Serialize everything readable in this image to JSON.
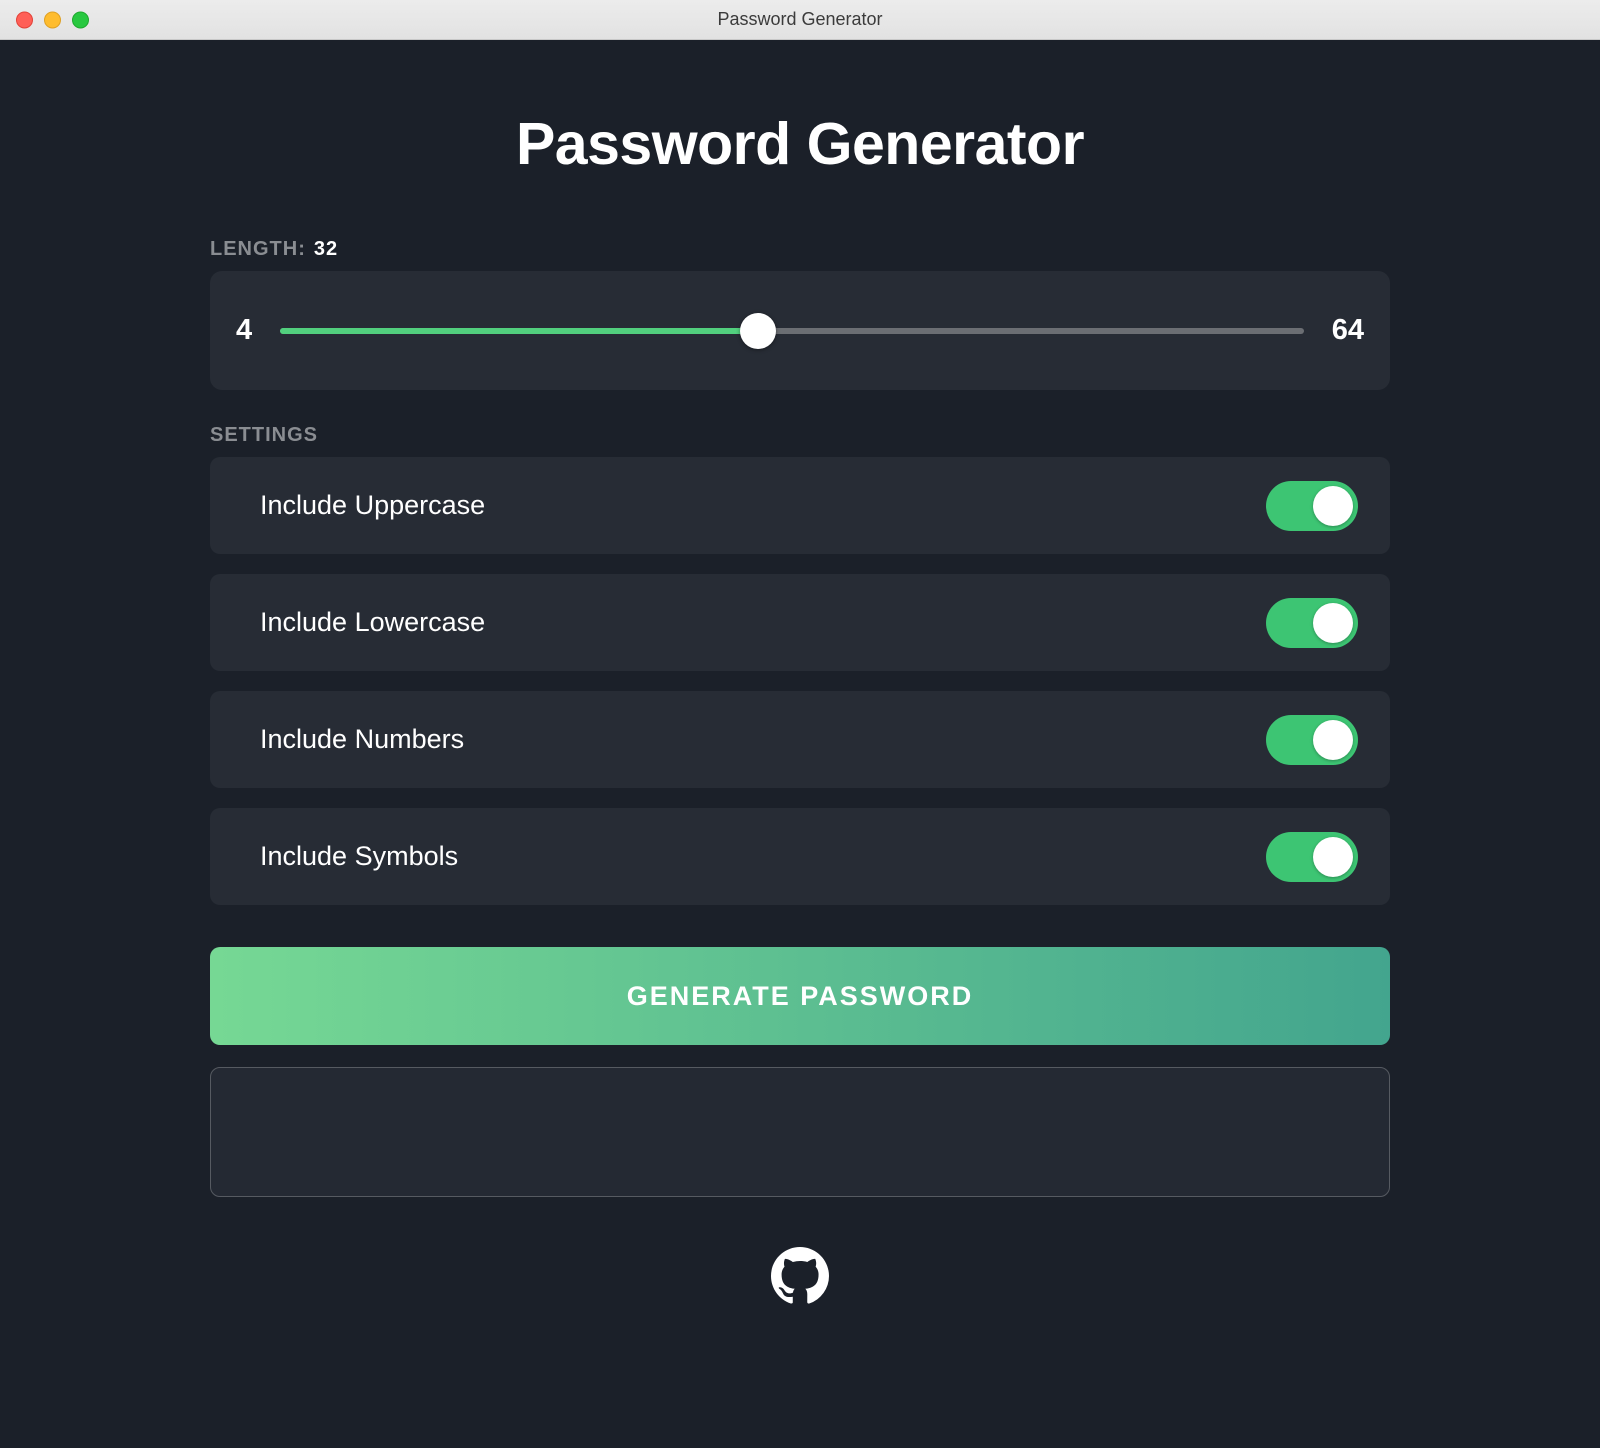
{
  "window": {
    "title": "Password Generator"
  },
  "header": {
    "title": "Password Generator"
  },
  "length": {
    "label": "LENGTH:",
    "value": "32",
    "min": "4",
    "max": "64",
    "min_num": 4,
    "max_num": 64,
    "value_num": 32
  },
  "settings": {
    "label": "SETTINGS",
    "items": [
      {
        "label": "Include Uppercase",
        "on": true
      },
      {
        "label": "Include Lowercase",
        "on": true
      },
      {
        "label": "Include Numbers",
        "on": true
      },
      {
        "label": "Include Symbols",
        "on": true
      }
    ]
  },
  "actions": {
    "generate": "GENERATE PASSWORD"
  },
  "output": {
    "value": ""
  },
  "footer": {
    "icon": "github-icon"
  },
  "colors": {
    "bg": "#1b2029",
    "card": "#272c35",
    "accent": "#3dc573",
    "text_muted": "#8a8d92"
  }
}
